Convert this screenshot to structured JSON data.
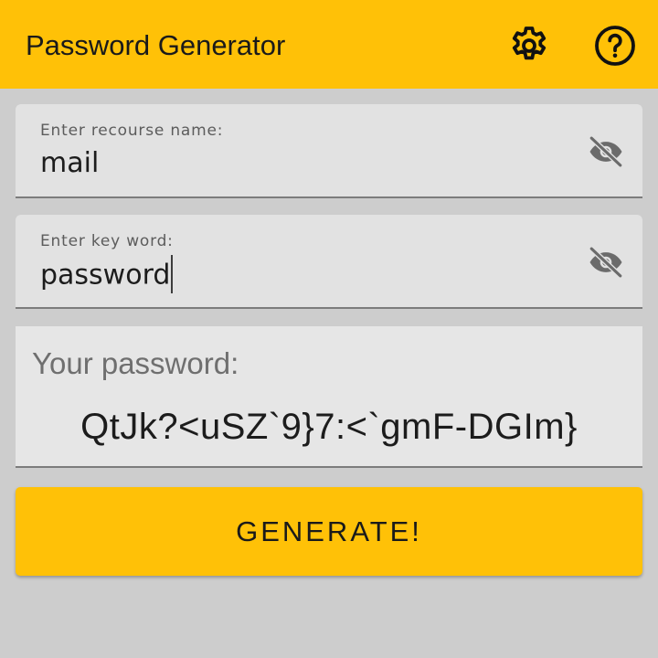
{
  "app_bar": {
    "title": "Password Generator",
    "actions": [
      {
        "name": "settings",
        "icon": "gear-icon"
      },
      {
        "name": "help",
        "icon": "help-circle-icon"
      }
    ],
    "color": "#ffc107"
  },
  "form": {
    "resource": {
      "label": "Enter recourse name:",
      "value": "mail",
      "visibility_icon": "eye-off-icon"
    },
    "keyword": {
      "label": "Enter key word:",
      "value": "password",
      "focused": true,
      "visibility_icon": "eye-off-icon"
    }
  },
  "result": {
    "label": "Your password:",
    "value": "QtJk?<uSZ`9}7:<`gmF-DGIm}"
  },
  "actions": {
    "generate_label": "GENERATE!"
  },
  "colors": {
    "accent": "#ffc107",
    "background": "#cdcdcd",
    "field_background": "#e2e2e2"
  }
}
